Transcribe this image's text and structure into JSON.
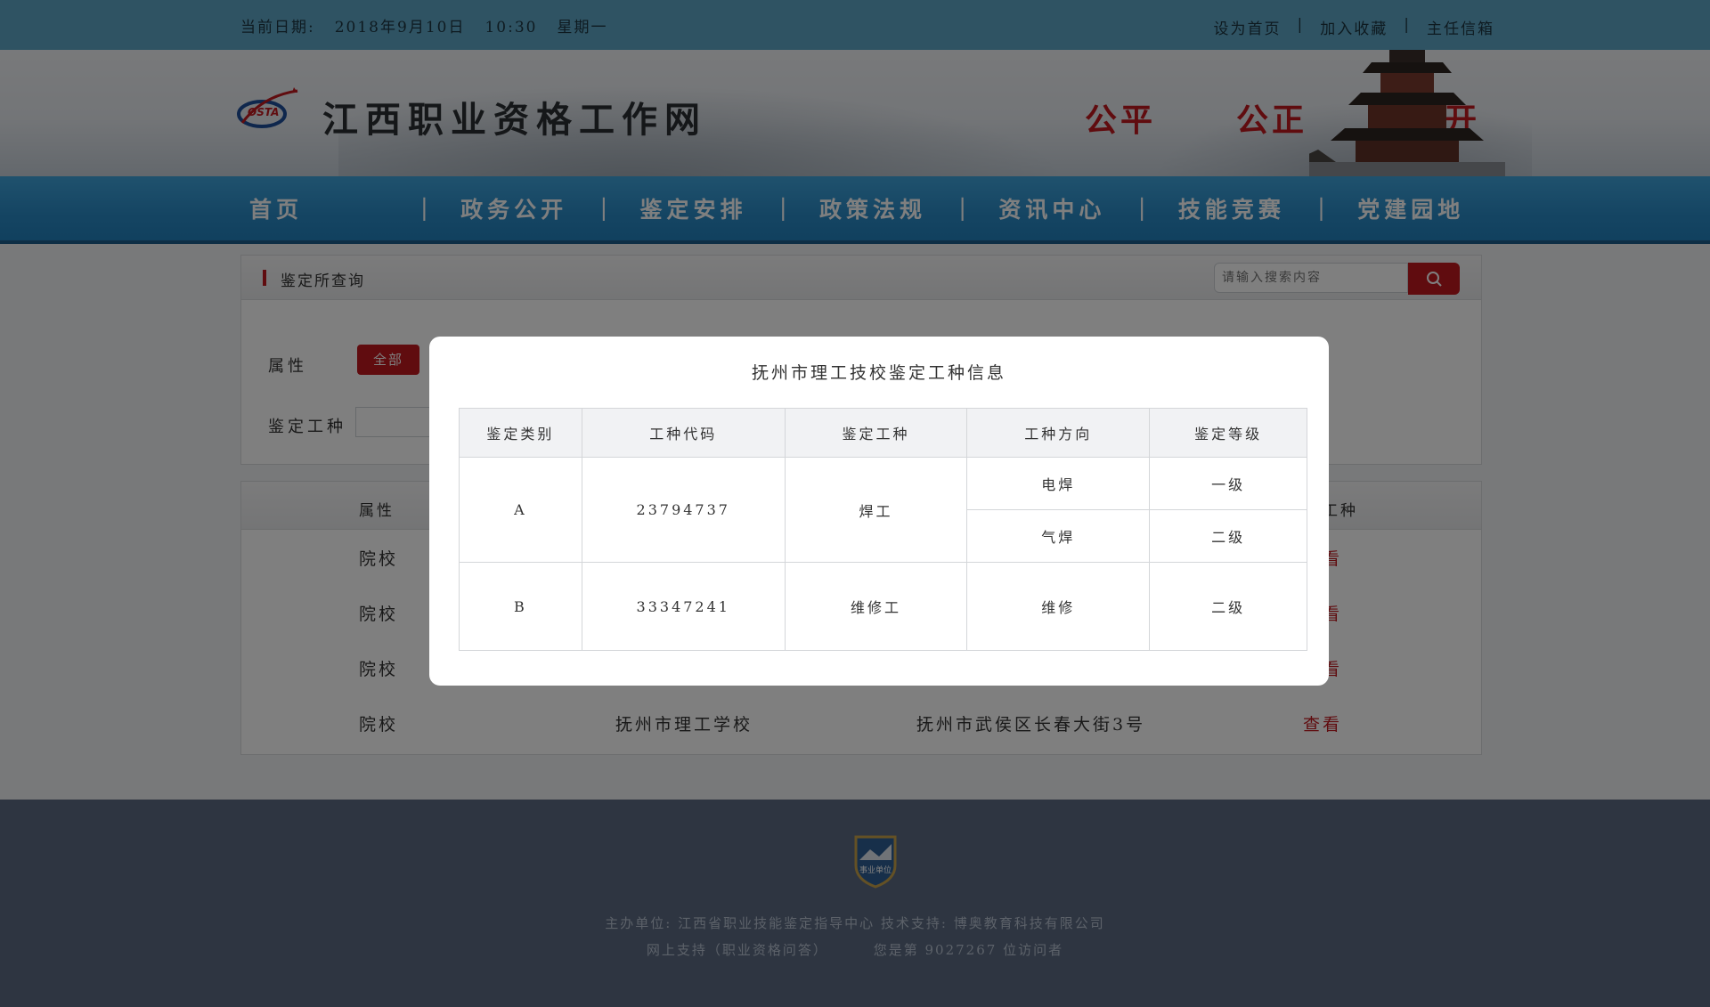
{
  "topbar": {
    "date_label": "当前日期:",
    "date": "2018年9月10日",
    "time": "10:30",
    "weekday": "星期一",
    "links": [
      "设为首页",
      "加入收藏",
      "主任信箱"
    ],
    "separator": "|"
  },
  "header": {
    "logo_text": "OSTA",
    "site_title": "江西职业资格工作网",
    "slogans": [
      "公平",
      "公正",
      "公开"
    ]
  },
  "nav": {
    "items": [
      "首页",
      "政务公开",
      "鉴定安排",
      "政策法规",
      "资讯中心",
      "技能竞赛",
      "党建园地"
    ],
    "separator": "|"
  },
  "search_panel": {
    "title": "鉴定所查询",
    "search_placeholder": "请输入搜索内容",
    "attribute_label": "属性",
    "attribute_selected": "全部",
    "work_type_label": "鉴定工种"
  },
  "results": {
    "columns": [
      "属性",
      "工种"
    ],
    "rows": [
      {
        "attr": "院校",
        "name": "",
        "address": "",
        "action": "查看"
      },
      {
        "attr": "院校",
        "name": "",
        "address": "",
        "action": "查看"
      },
      {
        "attr": "院校",
        "name": "",
        "address": "",
        "action": "查看"
      },
      {
        "attr": "院校",
        "name": "抚州市理工学校",
        "address": "抚州市武侯区长春大街3号",
        "action": "查看"
      }
    ]
  },
  "modal": {
    "title": "抚州市理工技校鉴定工种信息",
    "headers": [
      "鉴定类别",
      "工种代码",
      "鉴定工种",
      "工种方向",
      "鉴定等级"
    ],
    "rows": [
      {
        "category": "A",
        "code": "23794737",
        "work_type": "焊工",
        "directions": [
          {
            "direction": "电焊",
            "level": "一级"
          },
          {
            "direction": "气焊",
            "level": "二级"
          }
        ]
      },
      {
        "category": "B",
        "code": "33347241",
        "work_type": "维修工",
        "directions": [
          {
            "direction": "维修",
            "level": "二级"
          }
        ]
      }
    ]
  },
  "footer": {
    "badge_text": "事业单位",
    "host_label": "主办单位:",
    "host": "江西省职业技能鉴定指导中心",
    "tech_label": "技术支持:",
    "tech": "博奥教育科技有限公司",
    "support": "网上支持（职业资格问答）",
    "visitor_prefix": "您是第",
    "visitor_count": "9027267",
    "visitor_suffix": "位访问者"
  },
  "colors": {
    "brand_red": "#c0181e",
    "nav_blue": "#2a8ac6",
    "topbar_blue": "#5fa7c6",
    "footer_bg": "#5c6b82"
  }
}
